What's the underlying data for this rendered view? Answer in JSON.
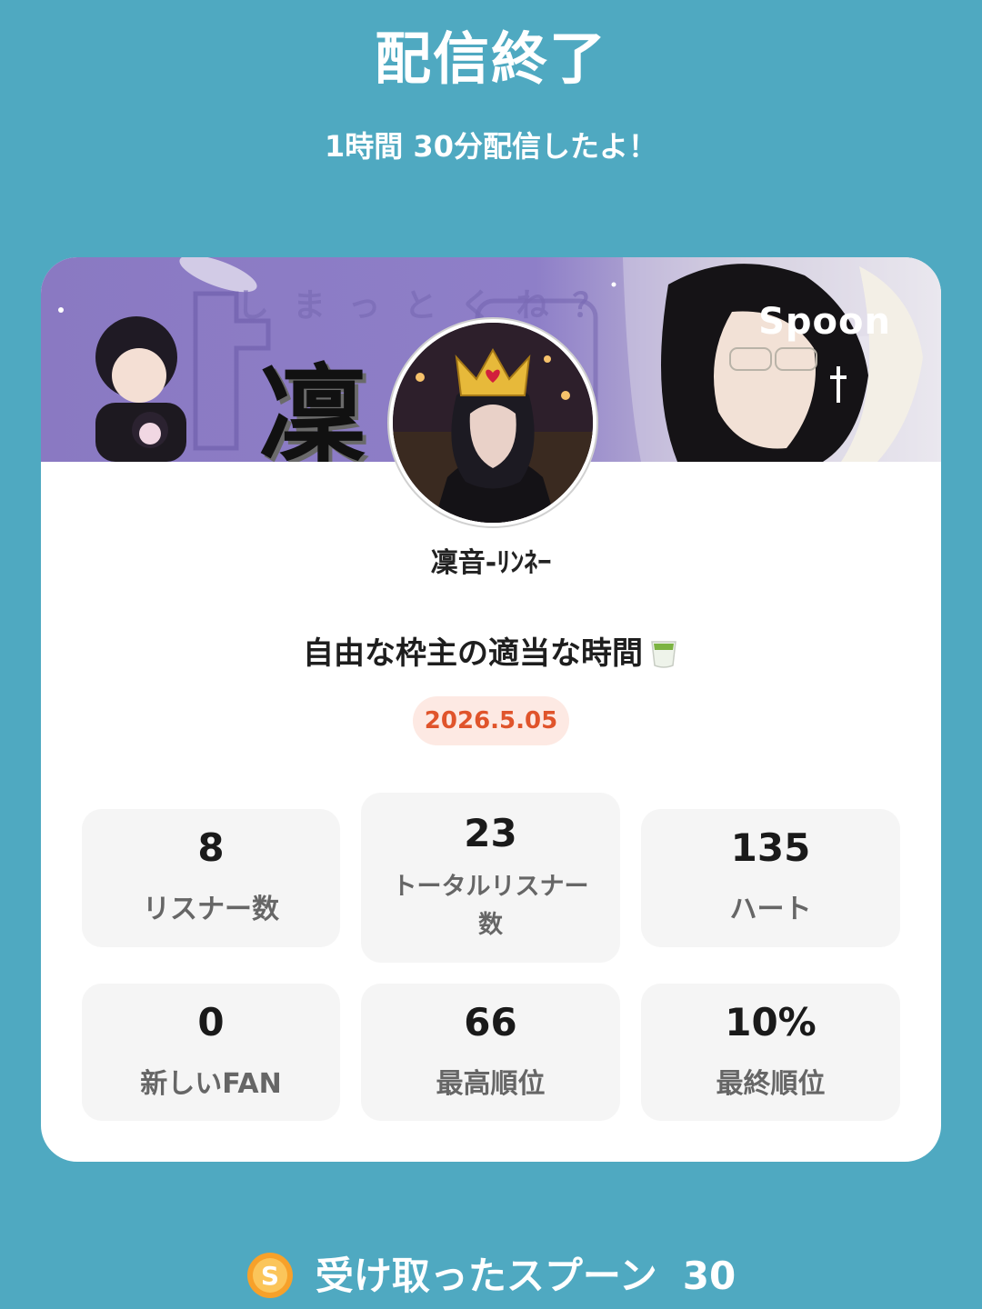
{
  "header": {
    "title": "配信終了",
    "subtitle": "1時間 30分配信したよ！"
  },
  "card": {
    "banner_logo": "Spoon",
    "banner_text_top": "しまっとくね？",
    "banner_kanji": "凜",
    "username": "凜音-ﾘﾝﾈｰ",
    "show_title": "自由な枠主の適当な時間",
    "date": "2026.5.05",
    "stats": [
      {
        "value": "8",
        "label": "リスナー数"
      },
      {
        "value": "23",
        "label": "トータルリスナー数"
      },
      {
        "value": "135",
        "label": "ハート"
      },
      {
        "value": "0",
        "label": "新しいFAN"
      },
      {
        "value": "66",
        "label": "最高順位"
      },
      {
        "value": "10%",
        "label": "最終順位"
      }
    ]
  },
  "footer": {
    "received_label": "受け取ったスプーン",
    "received_value": "30"
  },
  "colors": {
    "background": "#4fa9c1",
    "card": "#ffffff",
    "stat_box": "#f5f5f5",
    "date_text": "#e0542b",
    "date_bg": "#fde9e3"
  },
  "icons": [
    "tea-icon",
    "spoon-coin-icon",
    "spoon-logo"
  ]
}
